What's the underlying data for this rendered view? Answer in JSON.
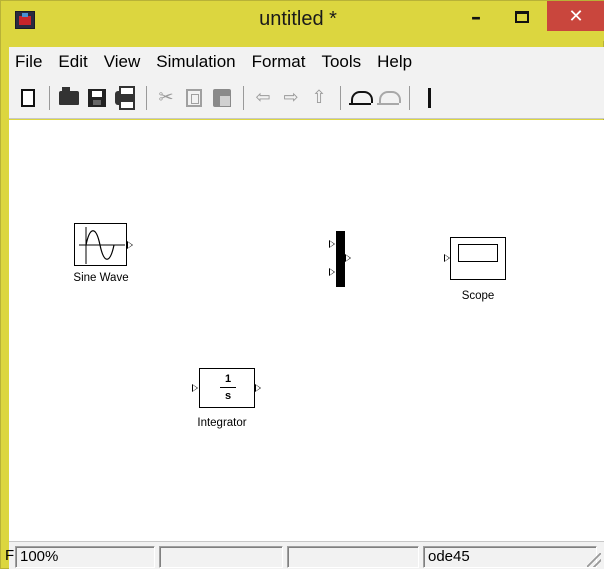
{
  "window": {
    "title": "untitled *",
    "minimize_glyph": "–",
    "close_glyph": "✕",
    "colors": {
      "frame": "#dcd63f",
      "close": "#c9463d",
      "canvas": "#ffffff"
    }
  },
  "menubar": {
    "items": [
      {
        "label": "File"
      },
      {
        "label": "Edit"
      },
      {
        "label": "View"
      },
      {
        "label": "Simulation"
      },
      {
        "label": "Format"
      },
      {
        "label": "Tools"
      },
      {
        "label": "Help"
      }
    ]
  },
  "toolbar": {
    "buttons": [
      {
        "icon": "new-file-icon",
        "enabled": true
      },
      {
        "icon": "open-folder-icon",
        "enabled": true
      },
      {
        "icon": "save-icon",
        "enabled": true
      },
      {
        "icon": "print-icon",
        "enabled": true
      },
      {
        "icon": "cut-icon",
        "enabled": false,
        "glyph": "✂"
      },
      {
        "icon": "copy-icon",
        "enabled": false
      },
      {
        "icon": "paste-icon",
        "enabled": false
      },
      {
        "icon": "back-arrow-icon",
        "enabled": false,
        "glyph": "⇦"
      },
      {
        "icon": "forward-arrow-icon",
        "enabled": false,
        "glyph": "⇨"
      },
      {
        "icon": "up-arrow-icon",
        "enabled": false,
        "glyph": "⇧"
      },
      {
        "icon": "undo-icon",
        "enabled": true
      },
      {
        "icon": "redo-icon",
        "enabled": false
      }
    ]
  },
  "canvas": {
    "blocks": {
      "sine_wave": {
        "label": "Sine Wave"
      },
      "mux": {
        "label": ""
      },
      "scope": {
        "label": "Scope"
      },
      "integrator": {
        "label": "Integrator",
        "numerator": "1",
        "denominator": "s"
      }
    }
  },
  "statusbar": {
    "cells": [
      {
        "text": "100%"
      },
      {
        "text": ""
      },
      {
        "text": ""
      },
      {
        "text": "ode45"
      }
    ],
    "left_fragment": "F"
  }
}
